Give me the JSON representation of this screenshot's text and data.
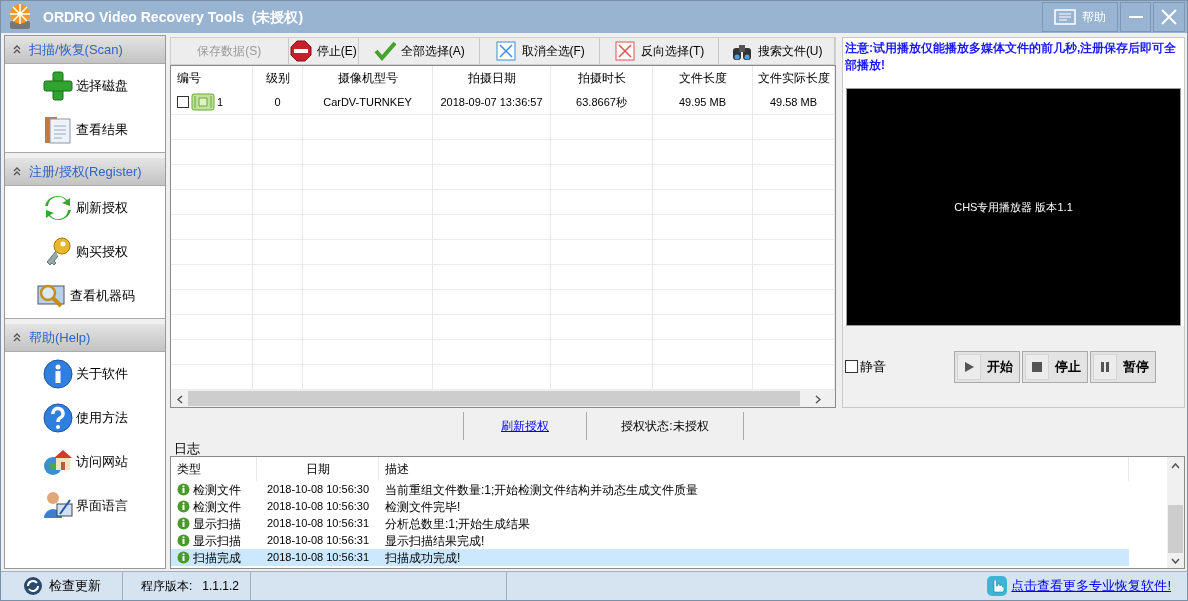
{
  "window": {
    "title": "ORDRO Video Recovery Tools  (未授权)",
    "help_label": "帮助"
  },
  "sidebar": [
    {
      "header": "扫描/恢复(Scan)",
      "expanded": true,
      "items": [
        "选择磁盘",
        "查看结果"
      ]
    },
    {
      "header": "注册/授权(Register)",
      "expanded": true,
      "items": [
        "刷新授权",
        "购买授权",
        "查看机器码"
      ]
    },
    {
      "header": "帮助(Help)",
      "expanded": true,
      "items": [
        "关于软件",
        "使用方法",
        "访问网站",
        "界面语言"
      ]
    }
  ],
  "toolbar": [
    {
      "label": "保存数据(S)",
      "disabled": true
    },
    {
      "label": "停止(E)",
      "disabled": false
    },
    {
      "label": "全部选择(A)",
      "disabled": false
    },
    {
      "label": "取消全选(F)",
      "disabled": false
    },
    {
      "label": "反向选择(T)",
      "disabled": false
    },
    {
      "label": "搜索文件(U)",
      "disabled": false
    }
  ],
  "table": {
    "columns": [
      "编号",
      "级别",
      "摄像机型号",
      "拍摄日期",
      "拍摄时长",
      "文件长度",
      "文件实际长度"
    ],
    "rows": [
      {
        "checked": false,
        "cells": [
          "1",
          "0",
          "CarDV-TURNKEY",
          "2018-09-07 13:36:57",
          "63.8667秒",
          "49.95 MB",
          "49.58 MB"
        ]
      }
    ]
  },
  "player": {
    "note": "注意:试用播放仅能播放多媒体文件的前几秒,注册保存后即可全部播放!",
    "screen_text": "CHS专用播放器 版本1.1",
    "mute": {
      "label": "静音",
      "checked": false
    },
    "buttons": [
      "开始",
      "停止",
      "暂停"
    ]
  },
  "status_strip": {
    "link": "刷新授权",
    "auth_state": "授权状态:未授权"
  },
  "log": {
    "title": "日志",
    "columns": [
      "类型",
      "日期",
      "描述"
    ],
    "rows": [
      {
        "type": "检测文件",
        "date": "2018-10-08 10:56:30",
        "text": "当前重组文件数量:1;开始检测文件结构并动态生成文件质量",
        "selected": false
      },
      {
        "type": "检测文件",
        "date": "2018-10-08 10:56:30",
        "text": "检测文件完毕!",
        "selected": false
      },
      {
        "type": "显示扫描",
        "date": "2018-10-08 10:56:31",
        "text": "分析总数里:1;开始生成结果",
        "selected": false
      },
      {
        "type": "显示扫描",
        "date": "2018-10-08 10:56:31",
        "text": "显示扫描结果完成!",
        "selected": false
      },
      {
        "type": "扫描完成",
        "date": "2018-10-08 10:56:31",
        "text": "扫描成功完成!",
        "selected": true
      }
    ]
  },
  "status_bar": {
    "update": "检查更新",
    "version_label": "程序版本:",
    "version": "1.1.1.2",
    "promo_link": "点击查看更多专业恢复软件!"
  }
}
